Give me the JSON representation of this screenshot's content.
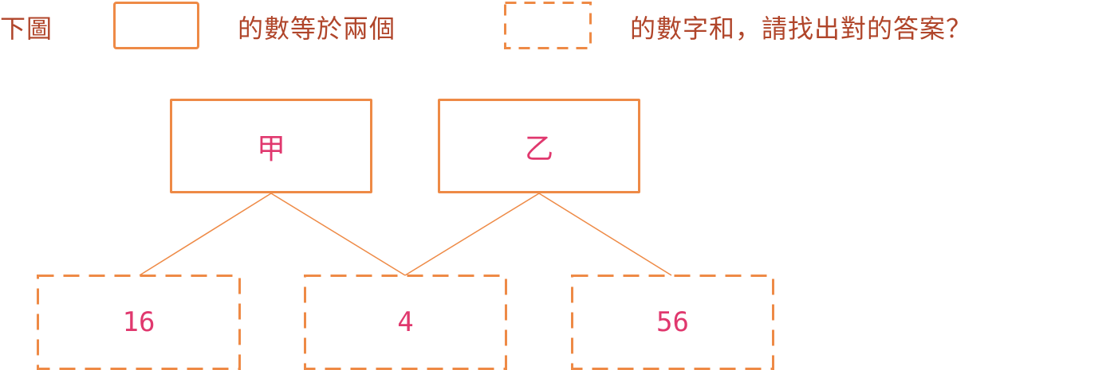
{
  "question": {
    "part1": "下圖",
    "part2": "的數等於兩個",
    "part3": "的數字和，請找出對的答案？"
  },
  "nodes": {
    "top": [
      {
        "label": "甲"
      },
      {
        "label": "乙"
      }
    ],
    "bottom": [
      {
        "value": "16"
      },
      {
        "value": "4"
      },
      {
        "value": "56"
      }
    ]
  },
  "colors": {
    "box_border": "#ee8a46",
    "question_text": "#b0452a",
    "value_text": "#e0386e"
  }
}
